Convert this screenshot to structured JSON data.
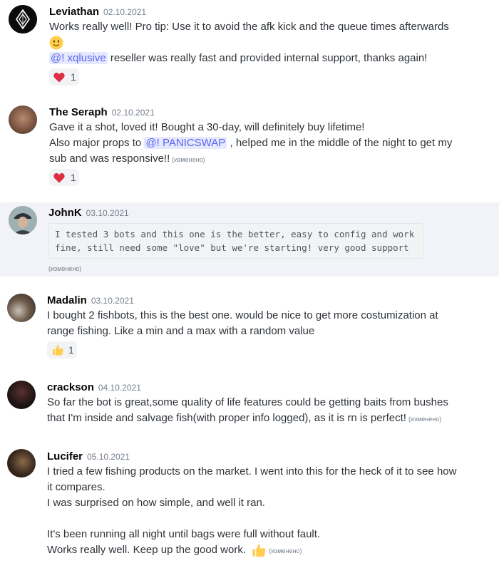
{
  "messages": [
    {
      "username": "Leviathan",
      "date": "02.10.2021",
      "line1": "Works really well! Pro tip: Use it to avoid the afk kick and the queue times afterwards",
      "mention": "@! xqlusive",
      "line3": " reseller was really fast and provided internal support, thanks again!",
      "reaction": {
        "emoji": "heart",
        "count": "1"
      }
    },
    {
      "username": "The Seraph",
      "date": "02.10.2021",
      "line1": "Gave it a shot, loved it! Bought a 30-day, will definitely buy lifetime!",
      "line2_pre": "Also major props to ",
      "mention": "@! PANICSWAP",
      "line2_post": " , helped me in the middle of the night to get my",
      "line3": "sub and was responsive!!",
      "edited": "(изменено)",
      "reaction": {
        "emoji": "heart",
        "count": "1"
      }
    },
    {
      "username": "JohnK",
      "date": "03.10.2021",
      "code_line1": "I tested 3 bots and this one is the better, easy to config and work",
      "code_line2": "fine, still need some \"love\" but we're starting! very good support",
      "edited": "(изменено)"
    },
    {
      "username": "Madalin",
      "date": "03.10.2021",
      "line1": "I bought 2 fishbots, this is the best one. would be nice to get more costumization at",
      "line2": "range fishing. Like a min and a max with a random value",
      "reaction": {
        "emoji": "thumbs-up",
        "count": "1"
      }
    },
    {
      "username": "crackson",
      "date": "04.10.2021",
      "line1": "So far the bot is great,some quality of life features could be getting baits from bushes",
      "line2": "that I'm inside and salvage fish(with proper info logged), as it is rn is perfect!",
      "edited": "(изменено)"
    },
    {
      "username": "Lucifer",
      "date": "05.10.2021",
      "line1": "I tried a few fishing products on the market. I went into this for the heck of it to see how",
      "line2": "it compares.",
      "line3": "I was surprised on how simple, and well it ran.",
      "line4": "It's been running all night until bags were full without fault.",
      "line5": "Works really well. Keep up the good work.",
      "edited": "(изменено)"
    }
  ],
  "colors": {
    "highlight_bg": "#f2f3f8",
    "mention_bg": "#e6e8fd",
    "mention_fg": "#5865f2",
    "heart": "#dd2e44",
    "thumb": "#ffcc4d"
  }
}
